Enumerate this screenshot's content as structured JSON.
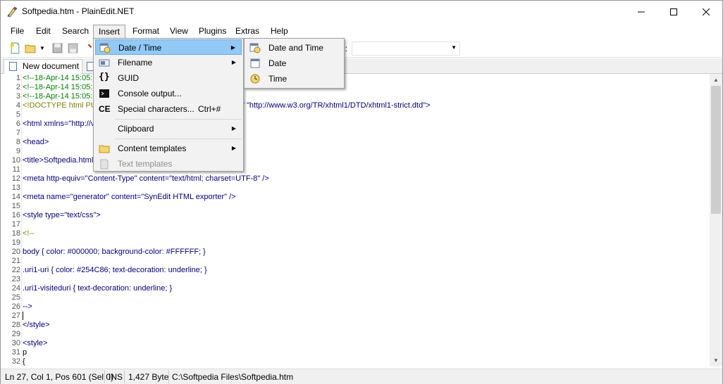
{
  "window": {
    "title": "Softpedia.htm - PlainEdit.NET"
  },
  "menubar": [
    "File",
    "Edit",
    "Search",
    "Insert",
    "Format",
    "View",
    "Plugins",
    "Extras",
    "Help"
  ],
  "toolbar": {
    "label": "n:"
  },
  "tabs": [
    {
      "label": "New document 1"
    }
  ],
  "editor": {
    "lines": [
      {
        "n": "1",
        "text": "<!--18-Apr-14 15:05:1"
      },
      {
        "n": "2",
        "text": "<!--18-Apr-14 15:05:1"
      },
      {
        "n": "3",
        "text": "<!--18-Apr-14 15:05:1"
      },
      {
        "n": "4",
        "text": "<!DOCTYPE html PU"
      },
      {
        "n": "6",
        "text": "<html xmlns=\"http://v"
      },
      {
        "n": "8",
        "text": "<head>"
      },
      {
        "n": "10",
        "text": "<title>Softpedia.html<"
      },
      {
        "n": "12",
        "text": "<meta http-equiv=\"Content-Type\" content=\"text/html; charset=UTF-8\" />"
      },
      {
        "n": "14",
        "text": "<meta name=\"generator\" content=\"SynEdit HTML exporter\" />"
      },
      {
        "n": "16",
        "text": "<style type=\"text/css\">"
      },
      {
        "n": "18",
        "text": "<!--"
      },
      {
        "n": "20",
        "text": "body { color: #000000; background-color: #FFFFFF; }"
      },
      {
        "n": "22",
        "text": ".uri1-uri { color: #254C86; text-decoration: underline; }"
      },
      {
        "n": "24",
        "text": ".uri1-visiteduri { text-decoration: underline; }"
      },
      {
        "n": "26",
        "text": "-->"
      },
      {
        "n": "27",
        "text": ""
      },
      {
        "n": "28",
        "text": "</style>"
      },
      {
        "n": "30",
        "text": "<style>"
      },
      {
        "n": "31",
        "text": "p"
      },
      {
        "n": "32",
        "text": "{"
      }
    ],
    "line4_tail": "\" \"http://www.w3.org/TR/xhtml1/DTD/xhtml1-strict.dtd\">",
    "blank_numbers": [
      "5",
      "7",
      "9",
      "11",
      "13",
      "15",
      "17",
      "19",
      "21",
      "23",
      "25",
      "29"
    ]
  },
  "insert_menu": {
    "items": [
      {
        "label": "Date / Time",
        "submenu": true,
        "icon": "calendar-clock-icon"
      },
      {
        "label": "Filename",
        "submenu": true,
        "icon": "filename-icon"
      },
      {
        "label": "GUID",
        "icon": "braces-icon"
      },
      {
        "label": "Console output...",
        "icon": "console-icon"
      },
      {
        "label": "Special characters...",
        "shortcut": "Ctrl+#",
        "icon": "special-chars-icon"
      },
      {
        "label": "Clipboard",
        "submenu": true
      },
      {
        "label": "Content templates",
        "submenu": true,
        "icon": "folder-icon"
      },
      {
        "label": "Text templates",
        "disabled": true,
        "icon": "folder-disabled-icon"
      }
    ]
  },
  "datetime_submenu": {
    "items": [
      {
        "label": "Date and Time",
        "icon": "calendar-clock-icon"
      },
      {
        "label": "Date",
        "icon": "calendar-icon"
      },
      {
        "label": "Time",
        "icon": "clock-icon"
      }
    ]
  },
  "status": {
    "position": "Ln 27, Col 1, Pos 601 (Sel 0)",
    "mode": "INS",
    "size": "1,427 Byte",
    "path": "C:\\Softpedia Files\\Softpedia.htm"
  },
  "colors": {
    "highlight": "#91c9f7",
    "comment": "#008000",
    "tag": "#000080"
  }
}
